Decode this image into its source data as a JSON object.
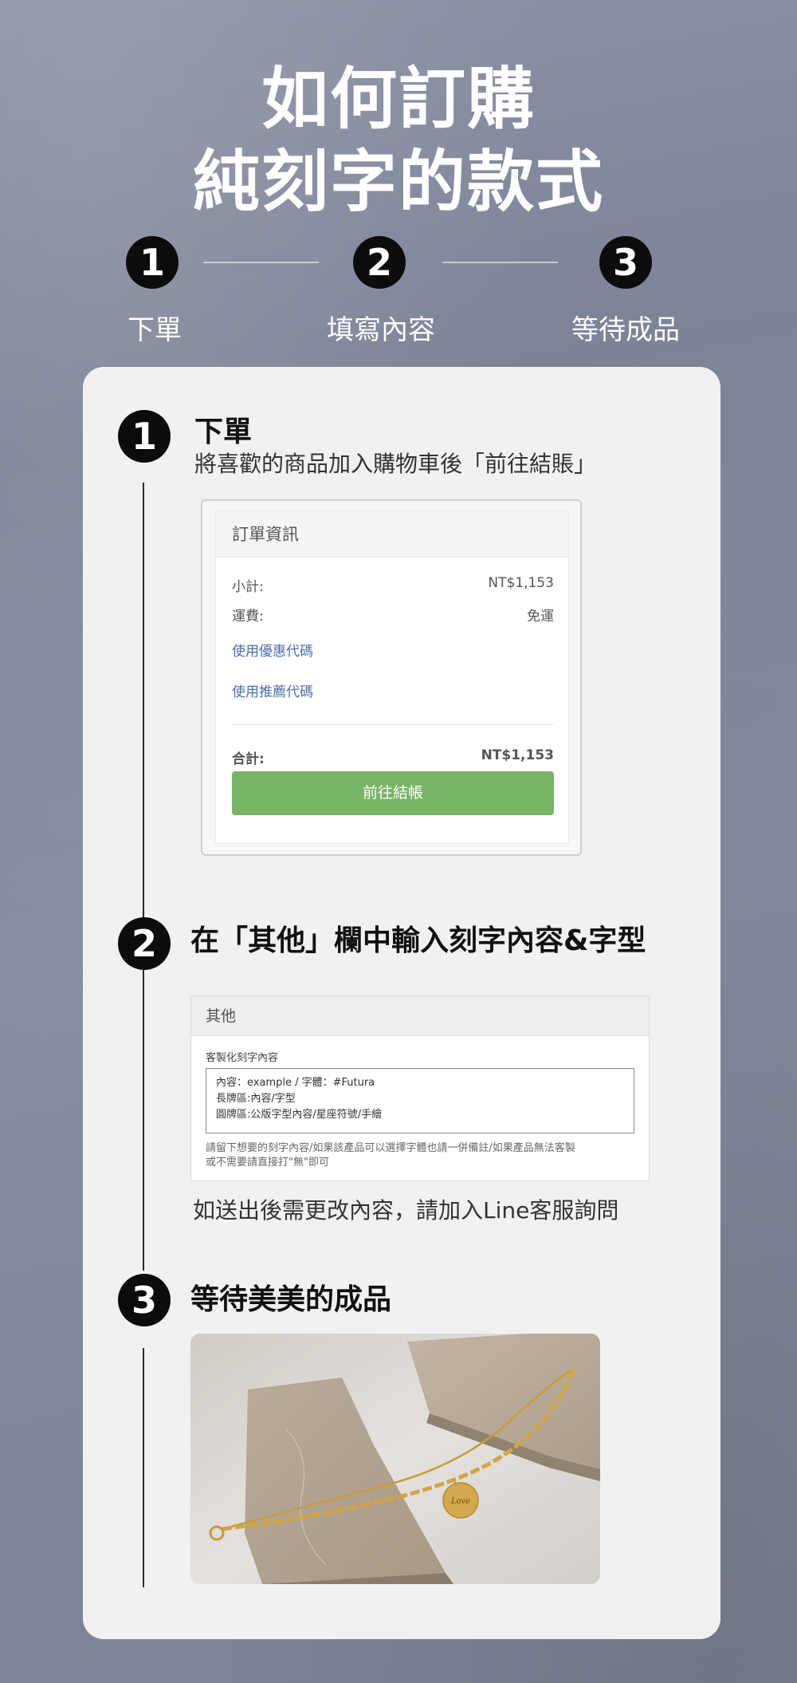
{
  "page_title": {
    "line1": "如何訂購",
    "line2": "純刻字的款式"
  },
  "steps": [
    {
      "number": "1",
      "label": "下單"
    },
    {
      "number": "2",
      "label": "填寫內容"
    },
    {
      "number": "3",
      "label": "等待成品"
    }
  ],
  "sections": [
    {
      "number": "1",
      "title": "下單",
      "desc": "將喜歡的商品加入購物車後「前往結賬」"
    },
    {
      "number": "2",
      "title": "在「其他」欄中輸入刻字內容&字型",
      "desc": "如送出後需更改內容，請加入Line客服詢問"
    },
    {
      "number": "3",
      "title": "等待美美的成品"
    }
  ],
  "order_panel": {
    "header": "訂單資訊",
    "subtotal_label": "小計:",
    "subtotal_value": "NT$1,153",
    "shipping_label": "運費:",
    "shipping_value": "免運",
    "coupon_link": "使用優惠代碼",
    "referral_link": "使用推薦代碼",
    "total_label": "合計:",
    "total_value": "NT$1,153",
    "checkout_button": "前往結帳",
    "checkout_color": "#77b466"
  },
  "other_panel": {
    "header": "其他",
    "field_label": "客製化刻字內容",
    "field_lines": [
      "內容：example / 字體：#Futura",
      "長牌區:內容/字型",
      "圓牌區:公版字型內容/星座符號/手繪"
    ],
    "hint_line1": "請留下想要的刻字內容/如果該產品可以選擇字體也請一併備註/如果產品無法客製",
    "hint_line2": "或不需要請直接打\"無\"即可"
  },
  "product_photo": {
    "pendant_text": "Love"
  }
}
